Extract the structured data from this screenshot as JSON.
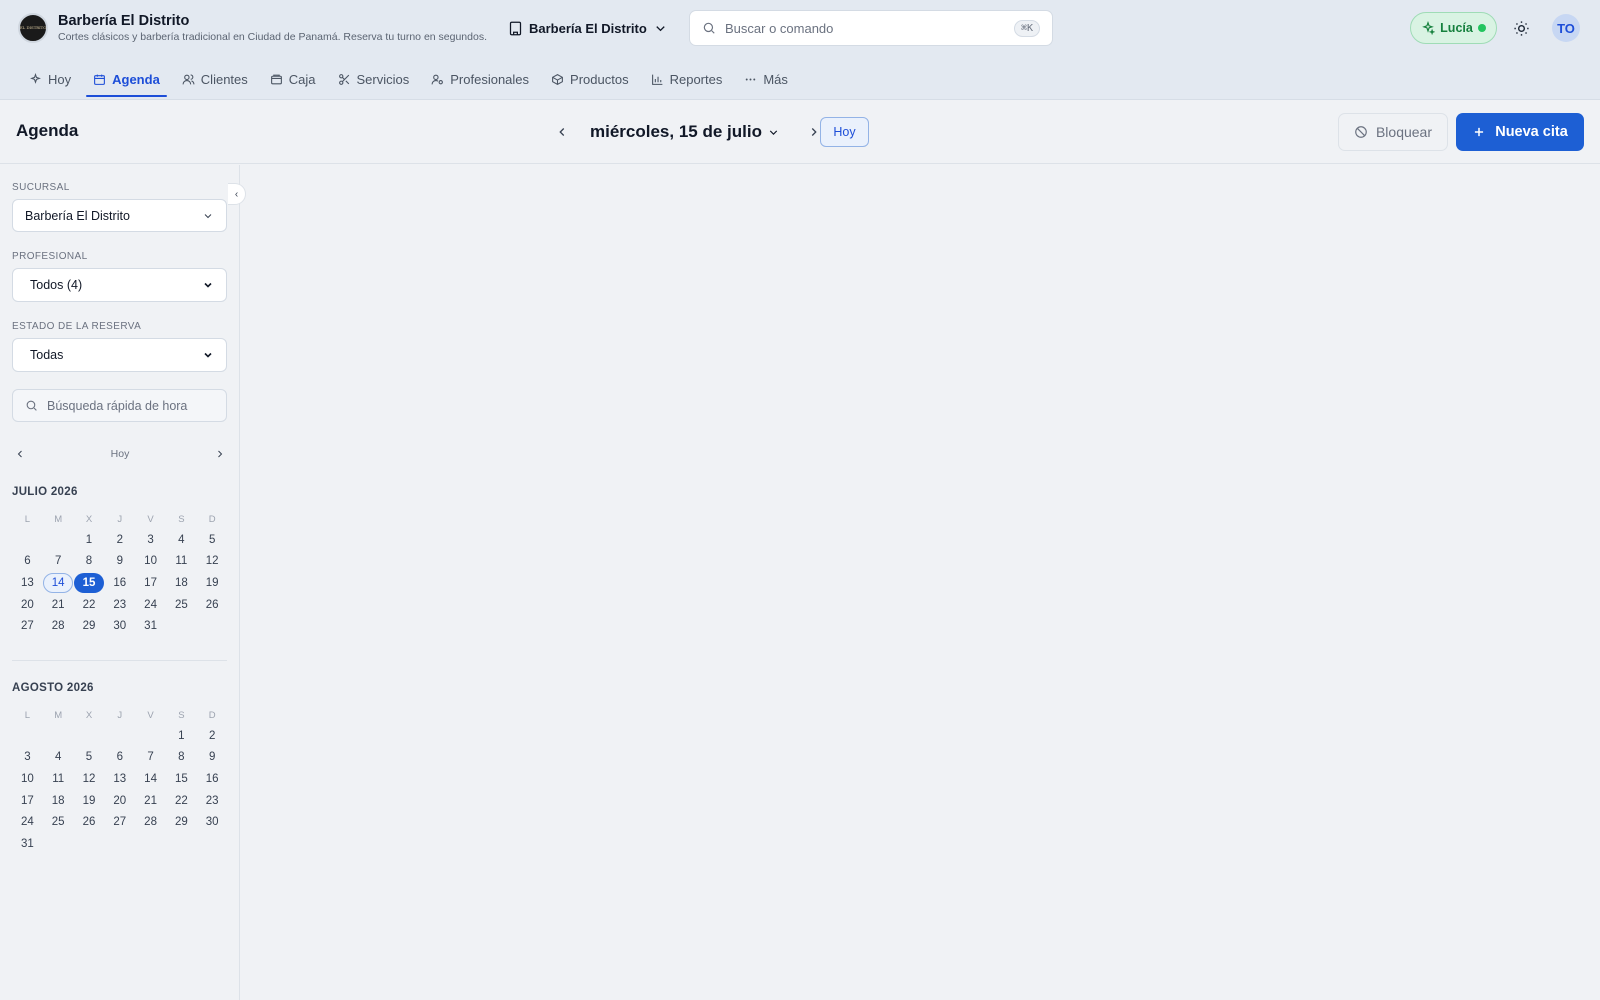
{
  "header": {
    "brand_name": "Barbería El Distrito",
    "brand_tagline": "Cortes clásicos y barbería tradicional en Ciudad de Panamá. Reserva tu turno en segundos.",
    "logo_text": "EL DISTRITO",
    "branch_label": "Barbería El Distrito",
    "search_placeholder": "Buscar o comando",
    "search_shortcut": "⌘K",
    "ai_assistant": "Lucía",
    "avatar_initials": "TO"
  },
  "nav": {
    "items": [
      {
        "label": "Hoy",
        "icon": "sparkle-icon"
      },
      {
        "label": "Agenda",
        "icon": "calendar-icon",
        "active": true
      },
      {
        "label": "Clientes",
        "icon": "users-icon"
      },
      {
        "label": "Caja",
        "icon": "wallet-icon"
      },
      {
        "label": "Servicios",
        "icon": "scissors-icon"
      },
      {
        "label": "Profesionales",
        "icon": "user-cog-icon"
      },
      {
        "label": "Productos",
        "icon": "box-icon"
      },
      {
        "label": "Reportes",
        "icon": "bar-chart-icon"
      },
      {
        "label": "Más",
        "icon": "more-icon"
      }
    ]
  },
  "toolbar": {
    "page_title": "Agenda",
    "current_date": "miércoles, 15 de julio",
    "today_label": "Hoy",
    "block_label": "Bloquear",
    "new_label": "Nueva cita"
  },
  "filters": {
    "branch_label": "SUCURSAL",
    "branch_value": "Barbería El Distrito",
    "pro_label": "PROFESIONAL",
    "pro_value": "Todos (4)",
    "status_label": "ESTADO DE LA RESERVA",
    "status_value": "Todas",
    "quick_search_placeholder": "Búsqueda rápida de hora"
  },
  "calendar": {
    "today_link": "Hoy",
    "weekdays": [
      "L",
      "M",
      "X",
      "J",
      "V",
      "S",
      "D"
    ],
    "today": 14,
    "selected": 15,
    "months": [
      {
        "title": "JULIO 2026",
        "offset": 2,
        "days": 31
      },
      {
        "title": "AGOSTO 2026",
        "offset": 5,
        "days": 31
      }
    ]
  },
  "colors": {
    "accent": "#1d5fd4",
    "ai_green": "#15803d"
  }
}
